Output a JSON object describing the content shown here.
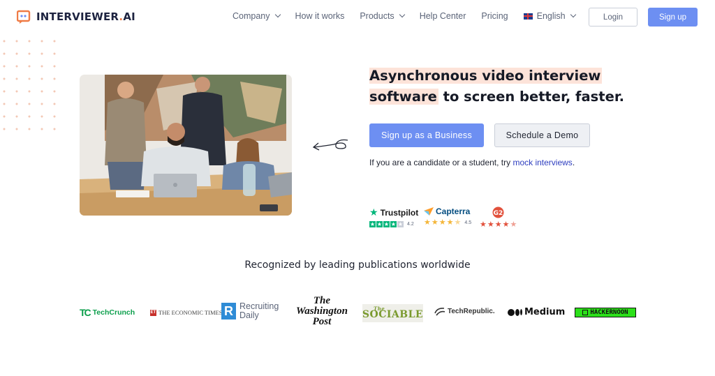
{
  "brand": {
    "name_main": "INTERVIEWER",
    "name_dot": ".",
    "name_suffix": "AI",
    "accent": "#ef7b45",
    "primary": "#6d8ff2",
    "highlight": "#fde3d9"
  },
  "nav": {
    "items": [
      {
        "label": "Company",
        "dropdown": true
      },
      {
        "label": "How it works",
        "dropdown": false
      },
      {
        "label": "Products",
        "dropdown": true
      },
      {
        "label": "Help Center",
        "dropdown": false
      },
      {
        "label": "Pricing",
        "dropdown": false
      }
    ],
    "language": {
      "label": "English",
      "icon": "uk-flag-icon",
      "dropdown": true
    },
    "login_label": "Login",
    "signup_label": "Sign up"
  },
  "hero": {
    "title_line1": "Asynchronous video interview",
    "title_line2_highlight": "software",
    "title_line2_rest": " to screen better, faster.",
    "primary_cta": "Sign up as a Business",
    "secondary_cta": "Schedule a Demo",
    "candidate_text": "If you are a candidate or a student, try ",
    "candidate_link": "mock interviews",
    "candidate_end": "."
  },
  "ratings": [
    {
      "name": "Trustpilot",
      "score": "4.2",
      "stars": 4,
      "icon": "trustpilot-star-icon"
    },
    {
      "name": "Capterra",
      "score": "4.5",
      "stars": 4.5,
      "icon": "capterra-arrow-icon"
    },
    {
      "name": "G2",
      "score": "",
      "stars": 4.5,
      "icon": "g2-logo-icon"
    }
  ],
  "publications": {
    "heading": "Recognized by leading publications worldwide",
    "techcrunch": {
      "mark": "TC",
      "name": "TechCrunch"
    },
    "economic_times": {
      "mark": "ET",
      "name": "THE ECONOMIC TIMES"
    },
    "recruiting_daily": {
      "mark": "R",
      "line1": "Recruiting",
      "line2": "Daily"
    },
    "washington_post": {
      "line1": "The",
      "line2": "Washington",
      "line3": "Post"
    },
    "sociable": {
      "name": "SOCIABLE",
      "prefix": "The"
    },
    "techrepublic": {
      "name": "TechRepublic."
    },
    "medium": {
      "name": "Medium"
    },
    "hackernoon": {
      "name": "HACKERNOON"
    }
  }
}
